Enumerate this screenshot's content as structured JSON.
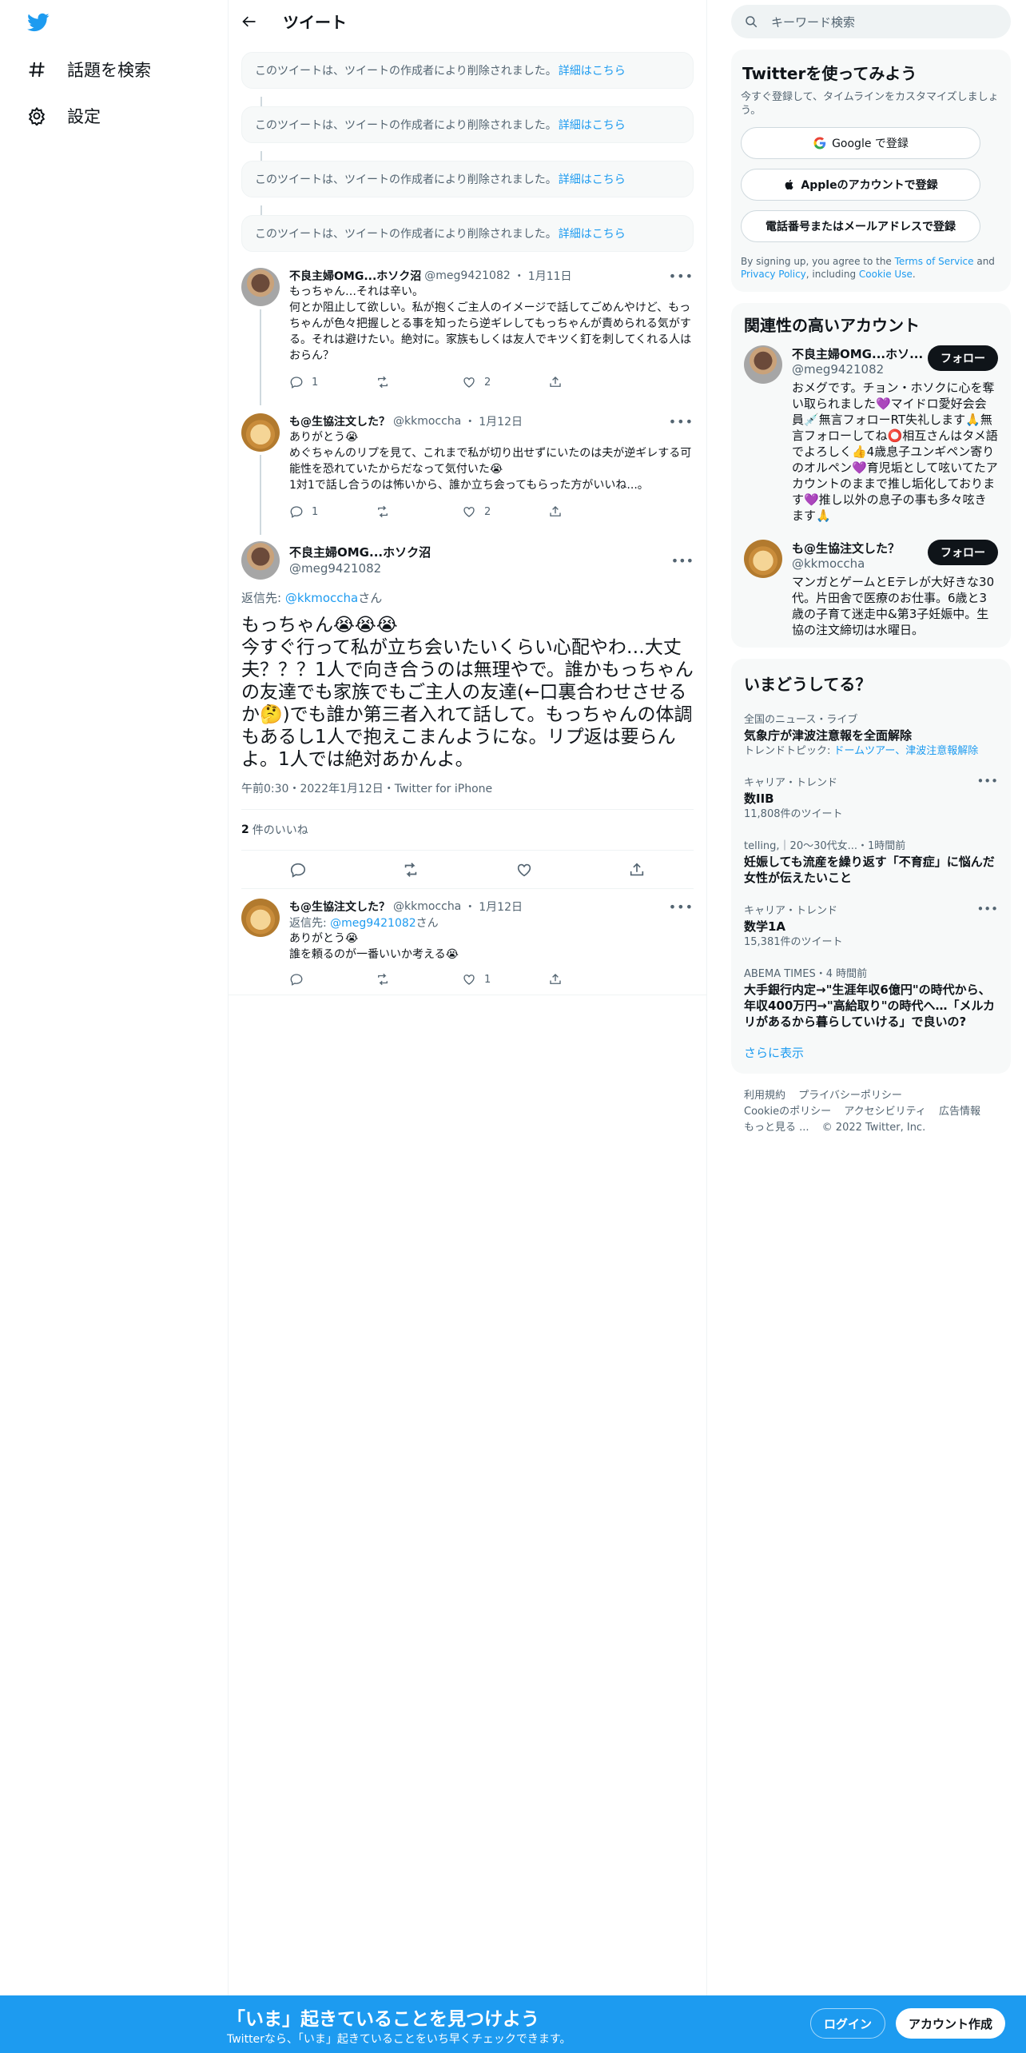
{
  "nav": {
    "items": [
      {
        "label": "話題を検索",
        "icon": "hashtag-icon"
      },
      {
        "label": "設定",
        "icon": "gear-icon"
      }
    ]
  },
  "header": {
    "title": "ツイート"
  },
  "deleted_tweets": [
    {
      "text": "このツイートは、ツイートの作成者により削除されました。",
      "link": "詳細はこちら"
    },
    {
      "text": "このツイートは、ツイートの作成者により削除されました。",
      "link": "詳細はこちら"
    },
    {
      "text": "このツイートは、ツイートの作成者により削除されました。",
      "link": "詳細はこちら"
    },
    {
      "text": "このツイートは、ツイートの作成者により削除されました。",
      "link": "詳細はこちら"
    }
  ],
  "tweets": [
    {
      "name": "不良主婦OMG...ホソク沼",
      "handle": "@meg9421082",
      "time": "1月11日",
      "text": "もっちゃん…それは辛い。\n何とか阻止して欲しい。私が抱くご主人のイメージで話してごめんやけど、もっちゃんが色々把握しとる事を知ったら逆ギレしてもっちゃんが責められる気がする。それは避けたい。絶対に。家族もしくは友人でキツく釘を刺してくれる人はおらん？",
      "replies": "1",
      "retweets": "",
      "likes": "2"
    },
    {
      "name": "も@生協注文した？",
      "handle": "@kkmoccha",
      "time": "1月12日",
      "text": "ありがとう😭\nめぐちゃんのリプを見て、これまで私が切り出せずにいたのは夫が逆ギレする可能性を恐れていたからだなって気付いた😭\n1対1で話し合うのは怖いから、誰か立ち会ってもらった方がいいね...。",
      "replies": "1",
      "retweets": "",
      "likes": "2"
    }
  ],
  "focus": {
    "name": "不良主婦OMG...ホソク沼",
    "handle": "@meg9421082",
    "replying_prefix": "返信先: ",
    "replying_to": "@kkmoccha",
    "replying_suffix": "さん",
    "text": "もっちゃん😭😭😭\n今すぐ行って私が立ち会いたいくらい心配やわ…大丈夫？？？1人で向き合うのは無理やで。誰かもっちゃんの友達でも家族でもご主人の友達(←口裏合わせさせるか🤔)でも誰か第三者入れて話して。もっちゃんの体調もあるし1人で抱えこまんようにな。リプ返は要らんよ。1人では絶対あかんよ。",
    "timestamp": "午前0:30・2022年1月12日・Twitter for iPhone",
    "like_count": "2",
    "like_label": "件のいいね"
  },
  "reply": {
    "name": "も@生協注文した？",
    "handle": "@kkmoccha",
    "time": "1月12日",
    "replying_prefix": "返信先: ",
    "replying_to": "@meg9421082",
    "replying_suffix": "さん",
    "text": "ありがとう😭\n誰を頼るのが一番いいか考える😭",
    "likes": "1"
  },
  "search": {
    "placeholder": "キーワード検索"
  },
  "signup": {
    "title": "Twitterを使ってみよう",
    "subtitle": "今すぐ登録して、タイムラインをカスタマイズしましょう。",
    "google": "Google で登録",
    "apple": "Appleのアカウントで登録",
    "phone": "電話番号またはメールアドレスで登録",
    "terms_pre": "By signing up, you agree to the ",
    "terms_link": "Terms of Service",
    "terms_and": " and ",
    "privacy_link": "Privacy Policy",
    "terms_mid": ", including ",
    "cookie_link": "Cookie Use",
    "terms_end": "."
  },
  "related": {
    "title": "関連性の高いアカウント",
    "follow_label": "フォロー",
    "accounts": [
      {
        "name": "不良主婦OMG...ホソ...",
        "handle": "@meg9421082",
        "bio": "おメグです。チョン・ホソクに心を奪い取られました💜マイドロ愛好会会員💉無言フォローRT失礼します🙏無言フォローしてね⭕相互さんはタメ語でよろしく👍4歳息子ユンギペン寄りのオルペン💜育児垢として呟いてたアカウントのままで推し垢化しております💜推し以外の息子の事も多々呟きます🙏"
      },
      {
        "name": "も@生協注文した？",
        "handle": "@kkmoccha",
        "bio": "マンガとゲームとEテレが大好きな30代。片田舎で医療のお仕事。6歳と3歳の子育て迷走中&第3子妊娠中。生協の注文締切は水曜日。"
      }
    ]
  },
  "trends": {
    "title": "いまどうしてる？",
    "items": [
      {
        "context": "全国のニュース・ライブ",
        "title": "気象庁が津波注意報を全面解除",
        "sub_prefix": "トレンドトピック: ",
        "sub_links": "ドームツアー、津波注意報解除",
        "has_more": false
      },
      {
        "context": "キャリア・トレンド",
        "title": "数IIB",
        "sub": "11,808件のツイート",
        "has_more": true
      },
      {
        "context": "telling,｜20～30代女...・1時間前",
        "title": "妊娠しても流産を繰り返す「不育症」に悩んだ女性が伝えたいこと",
        "has_more": false
      },
      {
        "context": "キャリア・トレンド",
        "title": "数学1A",
        "sub": "15,381件のツイート",
        "has_more": true
      },
      {
        "context": "ABEMA TIMES・4 時間前",
        "title": "大手銀行内定→\"生涯年収6億円\"の時代から、年収400万円→\"高給取り\"の時代へ…「メルカリがあるから暮らしていける」で良いの?",
        "has_more": false
      }
    ],
    "show_more": "さらに表示"
  },
  "footer": {
    "links": [
      "利用規約",
      "プライバシーポリシー",
      "Cookieのポリシー",
      "アクセシビリティ",
      "広告情報",
      "もっと見る ..."
    ],
    "copyright": "© 2022 Twitter, Inc."
  },
  "bottombar": {
    "headline": "「いま」起きていることを見つけよう",
    "subline": "Twitterなら、「いま」起きていることをいち早くチェックできます。",
    "login": "ログイン",
    "signup": "アカウント作成"
  },
  "colors": {
    "accent": "#1d9bf0",
    "text": "#0f1419",
    "muted": "#536471"
  }
}
